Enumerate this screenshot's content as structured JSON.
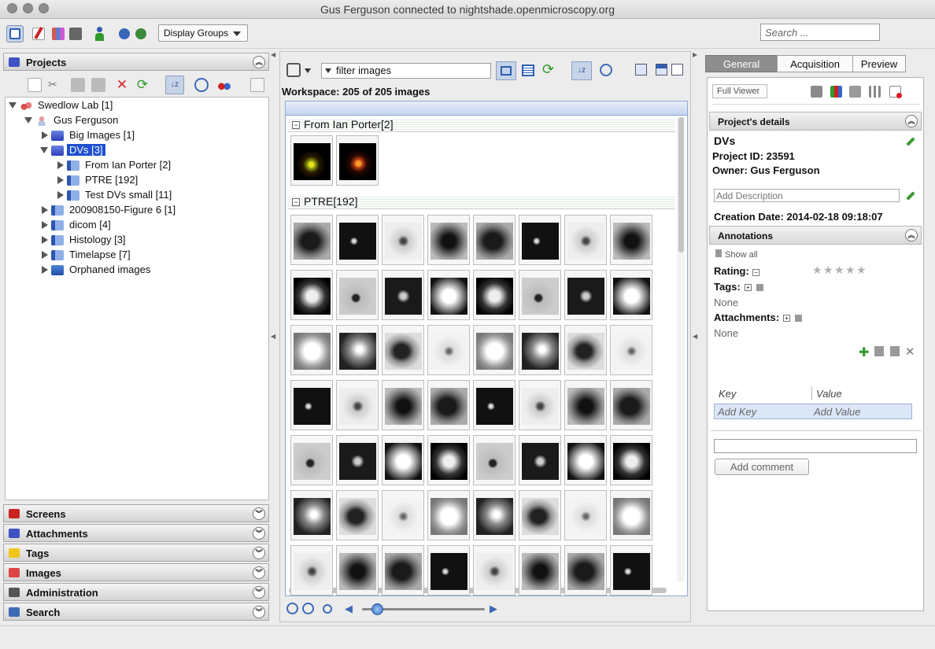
{
  "window": {
    "title": "Gus Ferguson connected to nightshade.openmicroscopy.org"
  },
  "toolbar": {
    "display_groups_label": "Display Groups",
    "search_placeholder": "Search ..."
  },
  "left": {
    "projects_label": "Projects",
    "tree": [
      {
        "label": "Swedlow Lab [1]",
        "depth": 0,
        "state": "open",
        "icon": "group-icon"
      },
      {
        "label": "Gus Ferguson",
        "depth": 1,
        "state": "open",
        "icon": "user-icon"
      },
      {
        "label": "Big Images [1]",
        "depth": 2,
        "state": "closed",
        "icon": "project-folder-icon"
      },
      {
        "label": "DVs [3]",
        "depth": 2,
        "state": "open",
        "icon": "project-folder-icon",
        "selected": true
      },
      {
        "label": "From Ian Porter [2]",
        "depth": 3,
        "state": "closed",
        "icon": "dataset-folder-icon"
      },
      {
        "label": "PTRE [192]",
        "depth": 3,
        "state": "closed",
        "icon": "dataset-folder-icon"
      },
      {
        "label": "Test DVs small [11]",
        "depth": 3,
        "state": "closed",
        "icon": "dataset-folder-icon"
      },
      {
        "label": "200908150-Figure 6 [1]",
        "depth": 2,
        "state": "closed",
        "icon": "dataset-folder-icon"
      },
      {
        "label": "dicom [4]",
        "depth": 2,
        "state": "closed",
        "icon": "dataset-folder-icon"
      },
      {
        "label": "Histology [3]",
        "depth": 2,
        "state": "closed",
        "icon": "dataset-folder-icon"
      },
      {
        "label": "Timelapse [7]",
        "depth": 2,
        "state": "closed",
        "icon": "dataset-folder-icon"
      },
      {
        "label": "Orphaned images",
        "depth": 2,
        "state": "closed",
        "icon": "orphaned-images-icon"
      }
    ],
    "sections": [
      "Screens",
      "Attachments",
      "Tags",
      "Images",
      "Administration",
      "Search"
    ]
  },
  "center": {
    "filter_text": "filter  images",
    "workspace_label": "Workspace: 205 of 205 images",
    "groups": [
      {
        "label": "From Ian Porter[2]"
      },
      {
        "label": "PTRE[192]"
      }
    ]
  },
  "right": {
    "tabs": [
      "General",
      "Acquisition",
      "Preview"
    ],
    "full_viewer_label": "Full Viewer",
    "details_header": "Project's details",
    "name": "DVs",
    "project_id": "Project ID: 23591",
    "owner": "Owner: Gus Ferguson",
    "description_placeholder": "Add Description",
    "creation_date": "Creation Date: 2014-02-18 09:18:07",
    "annotations_header": "Annotations",
    "show_all": "Show all",
    "rating_label": "Rating:",
    "rating_value": 0,
    "rating_max": 5,
    "tags_label": "Tags:",
    "tags_value": "None",
    "attachments_label": "Attachments:",
    "attachments_value": "None",
    "key_header": "Key",
    "value_header": "Value",
    "add_key": "Add Key",
    "add_value": "Add Value",
    "add_comment": "Add comment"
  },
  "colors": {
    "selection": "#1d4fd1",
    "accent_blue": "#3d6bb6",
    "green": "#2f9a2a",
    "red": "#d61f1f"
  }
}
